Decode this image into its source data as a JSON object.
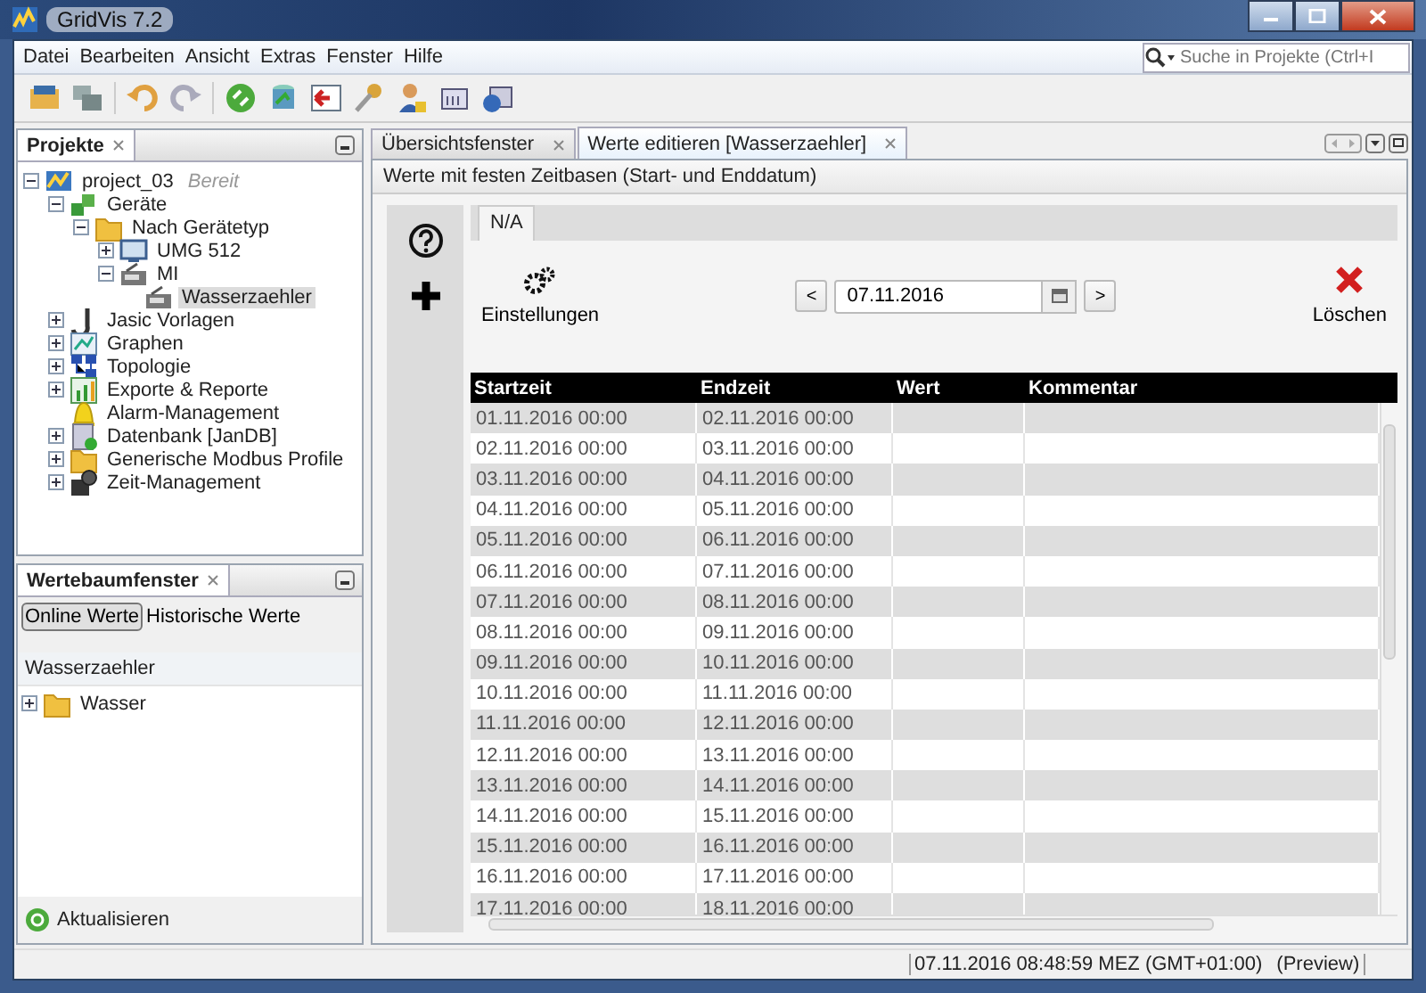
{
  "window": {
    "title": "GridVis 7.2"
  },
  "menu": [
    "Datei",
    "Bearbeiten",
    "Ansicht",
    "Extras",
    "Fenster",
    "Hilfe"
  ],
  "search": {
    "placeholder": "Suche in Projekte (Ctrl+I"
  },
  "projects_panel": {
    "title": "Projekte",
    "tree": [
      {
        "label": "project_03",
        "status": "Bereit",
        "kind": "project",
        "expanded": true,
        "selected": false,
        "children": [
          {
            "label": "Geräte",
            "kind": "devices",
            "expanded": true,
            "selected": false,
            "children": [
              {
                "label": "Nach Gerätetyp",
                "kind": "folder",
                "expanded": true,
                "selected": false,
                "children": [
                  {
                    "label": "UMG 512",
                    "kind": "monitor",
                    "expanded": false,
                    "selected": false
                  },
                  {
                    "label": "MI",
                    "kind": "meter",
                    "expanded": true,
                    "selected": false,
                    "children": [
                      {
                        "label": "Wasserzaehler",
                        "kind": "meter",
                        "selected": true
                      }
                    ]
                  }
                ]
              }
            ]
          },
          {
            "label": "Jasic Vorlagen",
            "kind": "script",
            "expanded": false,
            "selected": false
          },
          {
            "label": "Graphen",
            "kind": "chart",
            "expanded": false,
            "selected": false
          },
          {
            "label": "Topologie",
            "kind": "topology",
            "expanded": false,
            "selected": false
          },
          {
            "label": "Exporte & Reporte",
            "kind": "report",
            "expanded": false,
            "selected": false
          },
          {
            "label": "Alarm-Management",
            "kind": "bell",
            "selected": false
          },
          {
            "label": "Datenbank [JanDB]",
            "kind": "database",
            "expanded": false,
            "selected": false
          },
          {
            "label": "Generische Modbus Profile",
            "kind": "folder",
            "expanded": false,
            "selected": false
          },
          {
            "label": "Zeit-Management",
            "kind": "clock",
            "expanded": false,
            "selected": false
          }
        ]
      }
    ]
  },
  "values_panel": {
    "title": "Wertebaumfenster",
    "modes": [
      {
        "label": "Online Werte",
        "selected": true
      },
      {
        "label": "Historische Werte",
        "selected": false
      }
    ],
    "column": "Wasserzaehler",
    "tree": [
      {
        "label": "Wasser",
        "kind": "folder",
        "expanded": false,
        "selected": false
      }
    ],
    "refresh": "Aktualisieren"
  },
  "editor": {
    "tabs": [
      {
        "label": "Übersichtsfenster",
        "selected": false
      },
      {
        "label": "Werte editieren [Wasserzaehler]",
        "selected": true
      }
    ],
    "heading": "Werte mit festen Zeitbasen (Start- und Enddatum)",
    "subtabs": [
      {
        "label": "N/A",
        "selected": true
      }
    ],
    "settings": "Einstellungen",
    "prev": "<",
    "date": "07.11.2016",
    "next": ">",
    "delete": "Löschen",
    "table": {
      "columns": [
        "Startzeit",
        "Endzeit",
        "Wert",
        "Kommentar"
      ],
      "rows": [
        {
          "startzeit": "01.11.2016 00:00",
          "endzeit": "02.11.2016 00:00"
        },
        {
          "startzeit": "02.11.2016 00:00",
          "endzeit": "03.11.2016 00:00"
        },
        {
          "startzeit": "03.11.2016 00:00",
          "endzeit": "04.11.2016 00:00"
        },
        {
          "startzeit": "04.11.2016 00:00",
          "endzeit": "05.11.2016 00:00"
        },
        {
          "startzeit": "05.11.2016 00:00",
          "endzeit": "06.11.2016 00:00"
        },
        {
          "startzeit": "06.11.2016 00:00",
          "endzeit": "07.11.2016 00:00"
        },
        {
          "startzeit": "07.11.2016 00:00",
          "endzeit": "08.11.2016 00:00"
        },
        {
          "startzeit": "08.11.2016 00:00",
          "endzeit": "09.11.2016 00:00"
        },
        {
          "startzeit": "09.11.2016 00:00",
          "endzeit": "10.11.2016 00:00"
        },
        {
          "startzeit": "10.11.2016 00:00",
          "endzeit": "11.11.2016 00:00"
        },
        {
          "startzeit": "11.11.2016 00:00",
          "endzeit": "12.11.2016 00:00"
        },
        {
          "startzeit": "12.11.2016 00:00",
          "endzeit": "13.11.2016 00:00"
        },
        {
          "startzeit": "13.11.2016 00:00",
          "endzeit": "14.11.2016 00:00"
        },
        {
          "startzeit": "14.11.2016 00:00",
          "endzeit": "15.11.2016 00:00"
        },
        {
          "startzeit": "15.11.2016 00:00",
          "endzeit": "16.11.2016 00:00"
        },
        {
          "startzeit": "16.11.2016 00:00",
          "endzeit": "17.11.2016 00:00"
        },
        {
          "startzeit": "17.11.2016 00:00",
          "endzeit": "18.11.2016 00:00"
        }
      ]
    }
  },
  "status_bar": {
    "datetime": "07.11.2016 08:48:59 MEZ (GMT+01:00)",
    "mode": "(Preview)"
  }
}
